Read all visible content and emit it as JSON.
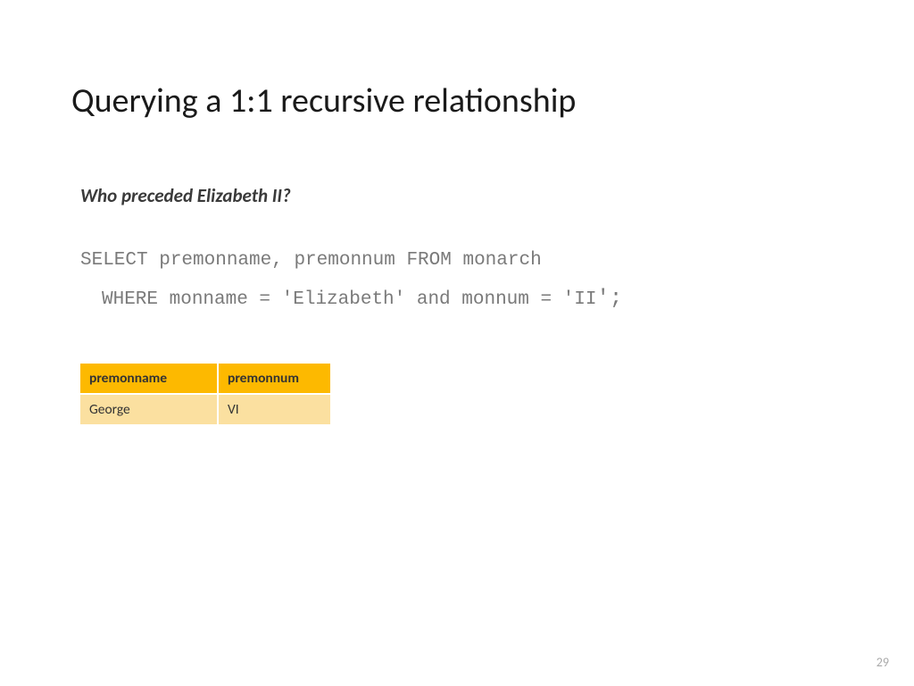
{
  "title": "Querying a 1:1  recursive relationship",
  "question": "Who preceded Elizabeth II?",
  "code": {
    "line1": "SELECT premonname, premonnum FROM monarch",
    "line2_pre": "WHERE monname = 'Elizabeth' and monnum = 'II",
    "line2_quote": "'",
    "line2_semi": ";"
  },
  "table": {
    "headers": [
      "premonname",
      "premonnum"
    ],
    "rows": [
      {
        "c0": "George",
        "c1": "VI"
      }
    ]
  },
  "page_number": "29"
}
